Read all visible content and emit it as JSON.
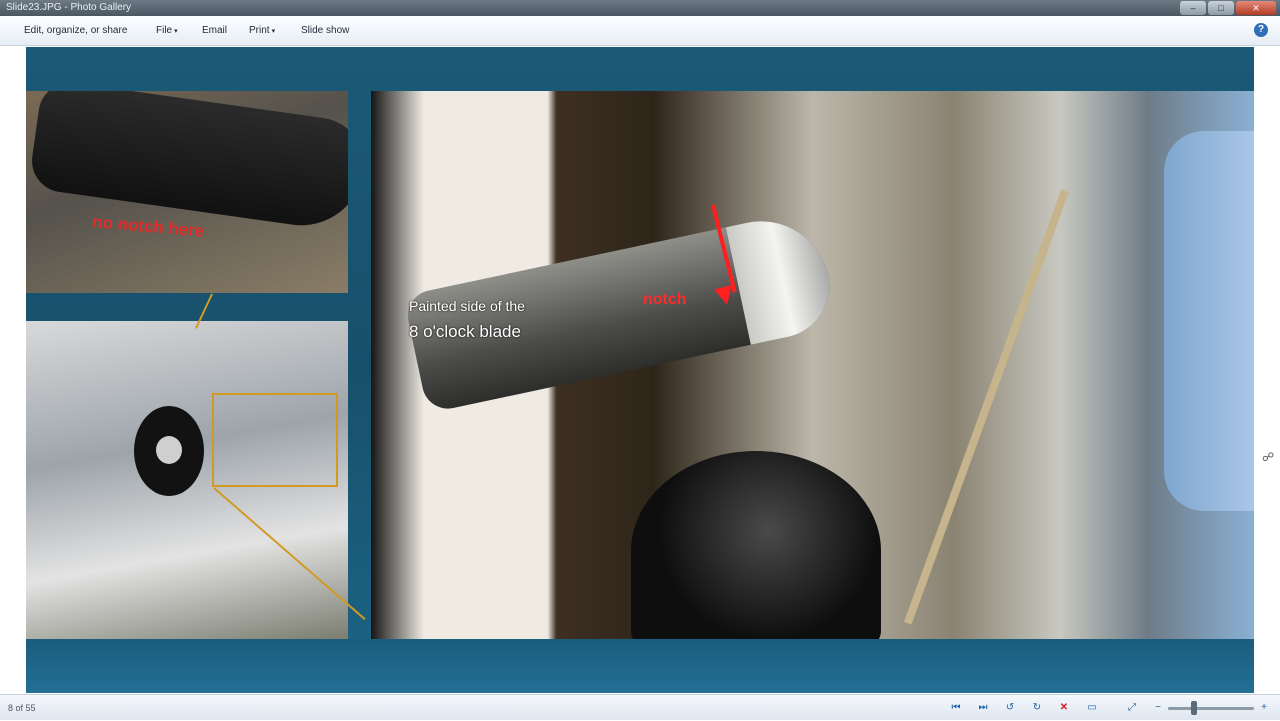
{
  "window": {
    "title": "Slide23.JPG - Photo Gallery",
    "minimize": "–",
    "maximize": "□",
    "close": "✕"
  },
  "menu": {
    "items": [
      {
        "label": "Edit, organize, or share"
      },
      {
        "label": "File",
        "caret": "▾"
      },
      {
        "label": "Email"
      },
      {
        "label": "Print",
        "caret": "▾"
      },
      {
        "label": "Slide show"
      }
    ],
    "help": "?"
  },
  "slide": {
    "label_no_notch": "no notch here",
    "label_painted_line1": "Painted side of the",
    "label_painted_line2": "8 o'clock blade",
    "label_notch": "notch",
    "accent_color": "#d29a22",
    "annotation_color": "#e52a2a"
  },
  "status": {
    "count": "8 of 55",
    "buttons": {
      "first": "⏮",
      "next": "⏭",
      "rotate_left": "↺",
      "rotate_right": "↻",
      "delete": "✕",
      "play": "▭",
      "fit": "⤢",
      "zoom_out": "−",
      "zoom_in": "+"
    },
    "zoom_level": 0.3
  }
}
